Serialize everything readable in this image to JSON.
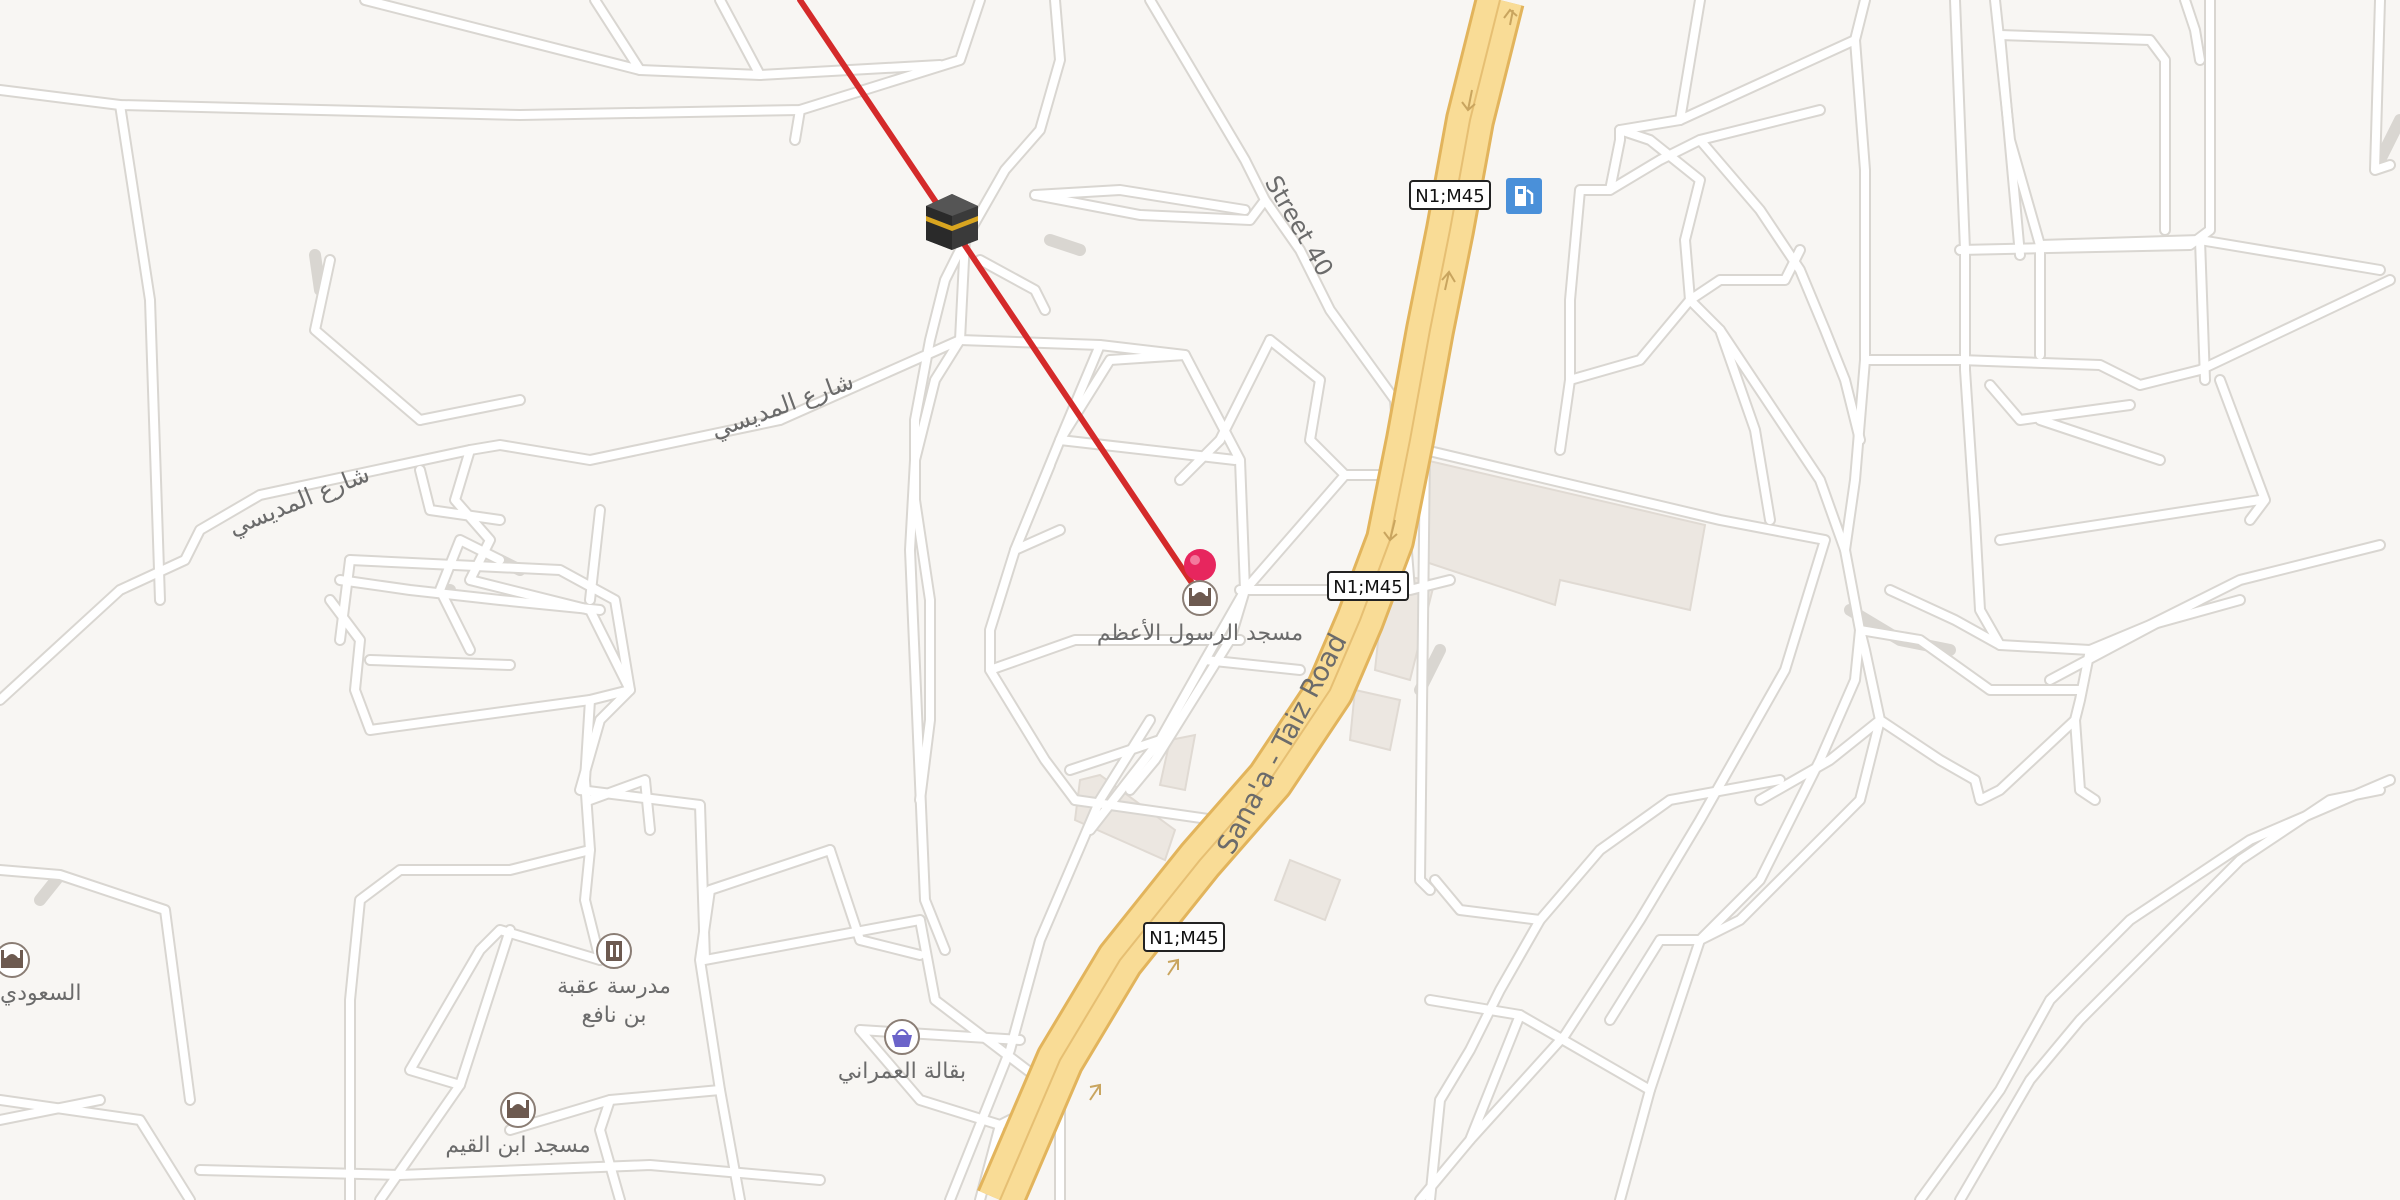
{
  "map": {
    "background_color": "#f8f6f3",
    "road_color": "#ffffff",
    "road_casing_color": "#d9d6d1",
    "highway_fill_color": "#f9dc96",
    "highway_casing_color": "#e2b45c",
    "building_color": "#ece7e1",
    "qibla_line_color": "#d42a2a",
    "pin_color": "#e7265e"
  },
  "route_shields": [
    {
      "id": "shield-1",
      "text": "N1;M45"
    },
    {
      "id": "shield-2",
      "text": "N1;M45"
    },
    {
      "id": "shield-3",
      "text": "N1;M45"
    }
  ],
  "street_labels": {
    "sanaa_taiz": "Sana'a - Taiz Road",
    "street_40": "Street 40",
    "almadisi_east": "شارع المديسي",
    "almadisi_west": "شارع المديسي"
  },
  "pois": {
    "selected_mosque": {
      "name": "مسجد الرسول الأعظم",
      "icon": "mosque-icon"
    },
    "school": {
      "name_line1": "مدرسة عقبة",
      "name_line2": "بن نافع",
      "icon": "school-icon"
    },
    "grocery": {
      "name": "بقالة العمراني",
      "icon": "basket-icon"
    },
    "mosque_ibn_qayyim": {
      "name": "مسجد ابن القيم",
      "icon": "mosque-icon"
    },
    "mosque_saudi": {
      "name": "السعودي",
      "icon": "mosque-icon"
    },
    "fuel": {
      "icon": "fuel-icon"
    },
    "kaaba": {
      "icon": "kaaba-icon"
    }
  }
}
